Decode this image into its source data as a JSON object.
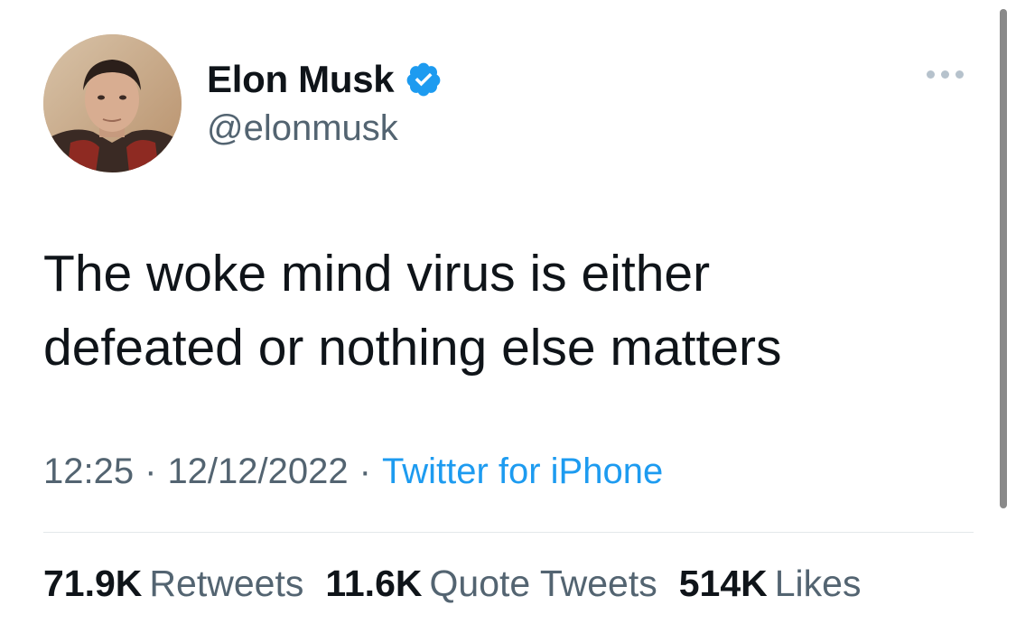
{
  "author": {
    "display_name": "Elon Musk",
    "handle": "@elonmusk",
    "verified": true,
    "verified_color": "#1d9bf0"
  },
  "icons": {
    "avatar": "profile-photo",
    "verified": "verified-badge-icon",
    "more": "more-options-icon"
  },
  "tweet": {
    "line1": "The woke mind virus is either",
    "line2": "defeated or nothing else matters"
  },
  "meta": {
    "time": "12:25",
    "separator": "·",
    "date": "12/12/2022",
    "source": "Twitter for iPhone"
  },
  "stats": {
    "retweets_count": "71.9K",
    "retweets_label": "Retweets",
    "quotes_count": "11.6K",
    "quotes_label": "Quote Tweets",
    "likes_count": "514K",
    "likes_label": "Likes"
  },
  "colors": {
    "text_primary": "#0f1419",
    "text_secondary": "#536471",
    "link": "#1d9bf0"
  }
}
